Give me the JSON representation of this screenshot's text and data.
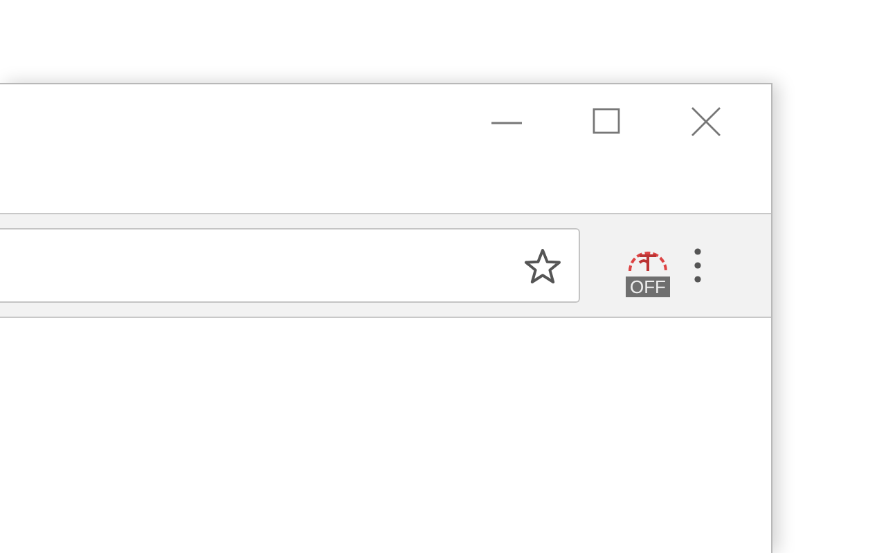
{
  "toolbar": {
    "extension": {
      "badge": "OFF"
    }
  }
}
